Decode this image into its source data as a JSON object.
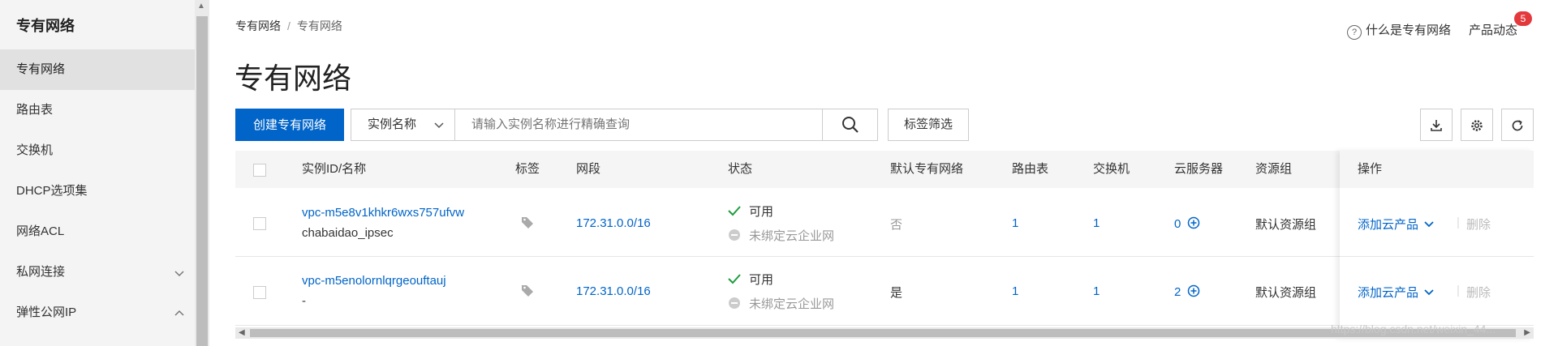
{
  "sidebar": {
    "title": "专有网络",
    "items": [
      {
        "label": "专有网络",
        "active": true
      },
      {
        "label": "路由表"
      },
      {
        "label": "交换机"
      },
      {
        "label": "DHCP选项集"
      },
      {
        "label": "网络ACL"
      },
      {
        "label": "私网连接",
        "chevron": "chevron-down"
      },
      {
        "label": "弹性公网IP",
        "chevron": "chevron-up"
      }
    ]
  },
  "breadcrumb": {
    "root": "专有网络",
    "separator": "/",
    "current": "专有网络"
  },
  "header": {
    "title": "专有网络",
    "help_link": "什么是专有网络",
    "news_link": "产品动态",
    "news_badge": "5"
  },
  "toolbar": {
    "create_label": "创建专有网络",
    "search_field": "实例名称",
    "search_placeholder": "请输入实例名称进行精确查询",
    "tag_filter_label": "标签筛选"
  },
  "table": {
    "columns": [
      "实例ID/名称",
      "标签",
      "网段",
      "状态",
      "默认专有网络",
      "路由表",
      "交换机",
      "云服务器",
      "资源组",
      "操作"
    ],
    "rows": [
      {
        "id": "vpc-m5e8v1khkr6wxs757ufvw",
        "name": "chabaidao_ipsec",
        "cidr": "172.31.0.0/16",
        "status": "可用",
        "cen_status": "未绑定云企业网",
        "default_vpc": "否",
        "route_tables": "1",
        "vswitches": "1",
        "ecs": "0",
        "resource_group": "默认资源组",
        "action_add": "添加云产品",
        "action_delete": "删除"
      },
      {
        "id": "vpc-m5enolornlqrgeouftauj",
        "name": "-",
        "cidr": "172.31.0.0/16",
        "status": "可用",
        "cen_status": "未绑定云企业网",
        "default_vpc": "是",
        "route_tables": "1",
        "vswitches": "1",
        "ecs": "2",
        "resource_group": "默认资源组",
        "action_add": "添加云产品",
        "action_delete": "删除"
      }
    ]
  },
  "colors": {
    "primary": "#0064c8",
    "success": "#1f9c3d",
    "badge": "#e4393c"
  },
  "watermark": "https://blog.csdn.net/weixin_44..."
}
